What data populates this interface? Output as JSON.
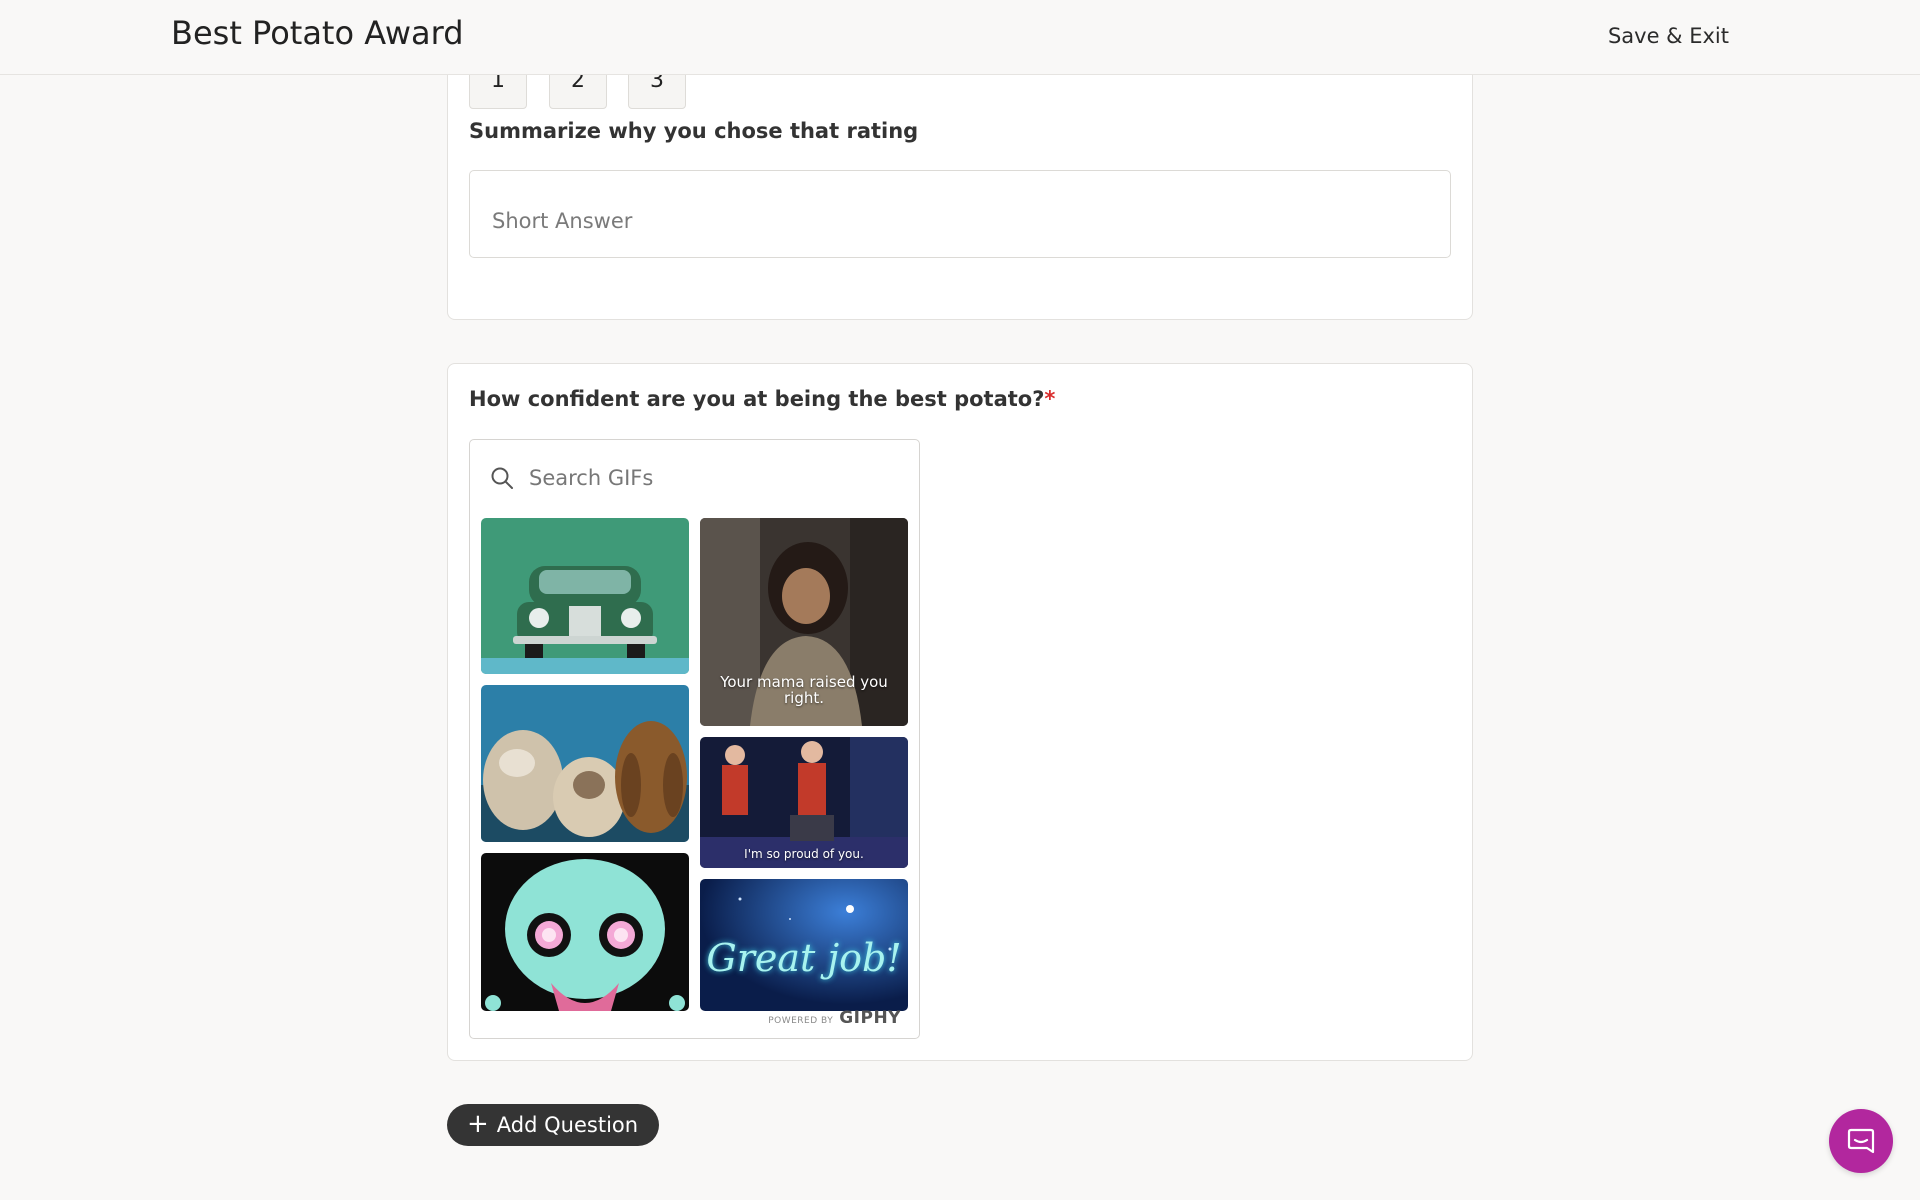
{
  "header": {
    "title": "Best Potato Award",
    "save_exit": "Save & Exit"
  },
  "rating_question": {
    "options": [
      "1",
      "2",
      "3"
    ]
  },
  "summary_question": {
    "label": "Summarize why you chose that rating",
    "placeholder": "Short Answer"
  },
  "gif_question": {
    "label": "How confident are you at being the best potato?",
    "required_mark": "*",
    "search_placeholder": "Search GIFs",
    "gifs": [
      {
        "name": "gif-green-car"
      },
      {
        "name": "gif-woman",
        "caption": "Your mama raised you right."
      },
      {
        "name": "gif-dogs"
      },
      {
        "name": "gif-gym",
        "caption": "I'm so proud of you."
      },
      {
        "name": "gif-skull"
      },
      {
        "name": "gif-great-job",
        "caption": "Great job!"
      }
    ],
    "credit_small": "POWERED BY",
    "credit_brand": "GIPHY"
  },
  "actions": {
    "add_question": "Add Question"
  },
  "icons": {
    "search": "search-icon",
    "plus": "plus-icon",
    "chat": "chat-icon"
  },
  "colors": {
    "accent_chat": "#b2279e",
    "dark_button": "#343434",
    "required": "#d92d2d"
  }
}
